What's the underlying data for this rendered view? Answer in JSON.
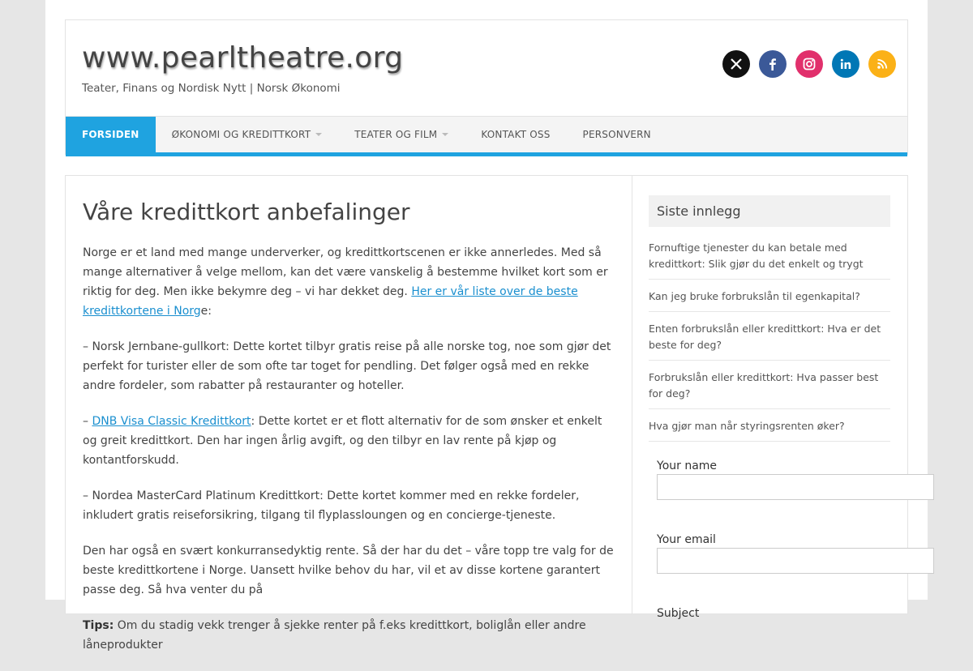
{
  "header": {
    "site_title": "www.pearltheatre.org",
    "tagline": "Teater, Finans og Nordisk Nytt | Norsk Økonomi"
  },
  "social": [
    {
      "name": "x-icon",
      "color": "#111111"
    },
    {
      "name": "facebook-icon",
      "color": "#3b5998"
    },
    {
      "name": "instagram-icon",
      "color": "#e1306c"
    },
    {
      "name": "linkedin-icon",
      "color": "#0077b5"
    },
    {
      "name": "rss-icon",
      "color": "#fbb117"
    }
  ],
  "nav": {
    "items": [
      {
        "label": "FORSIDEN"
      },
      {
        "label": "ØKONOMI OG KREDITTKORT"
      },
      {
        "label": "TEATER OG FILM"
      },
      {
        "label": "KONTAKT OSS"
      },
      {
        "label": "PERSONVERN"
      }
    ]
  },
  "accent_color": "#1fa3e0",
  "article": {
    "title": "Våre kredittkort anbefalinger",
    "p1_text": "Norge er et land med mange underverker, og kredittkortscenen er ikke annerledes. Med så mange alternativer å velge mellom, kan det være vanskelig å bestemme hvilket kort som er riktig for deg. Men ikke bekymre deg – vi har dekket deg. ",
    "p1_link": "Her er vår liste over de beste kredittkortene i Norg",
    "p1_end": "e:",
    "p2": "– Norsk Jernbane-gullkort: Dette kortet tilbyr gratis reise på alle norske tog, noe som gjør det perfekt for turister eller de som ofte tar toget for pendling. Det følger også med en rekke andre fordeler, som rabatter på restauranter og hoteller.",
    "p3_prefix": "– ",
    "p3_link": "DNB Visa Classic Kredittkort",
    "p3_text": ": Dette kortet er et flott alternativ for de som ønsker et enkelt og greit kredittkort. Den har ingen årlig avgift, og den tilbyr en lav rente på kjøp og kontantforskudd.",
    "p4": "– Nordea MasterCard Platinum Kredittkort: Dette kortet kommer med en rekke fordeler, inkludert gratis reiseforsikring, tilgang til flyplassloungen og en concierge-tjeneste.",
    "p5": "Den har også en svært konkurransedyktig rente. Så der har du det – våre topp tre valg for de beste kredittkortene i Norge. Uansett hvilke behov du har, vil et av disse kortene garantert passe deg. Så hva venter du på",
    "tips_label": "Tips:",
    "tips_text": " Om du stadig vekk trenger å sjekke renter på f.eks kredittkort, boliglån eller andre låneprodukter"
  },
  "sidebar": {
    "widget_title": "Siste innlegg",
    "posts": [
      {
        "label": "Fornuftige tjenester du kan betale med kredittkort: Slik gjør du det enkelt og trygt"
      },
      {
        "label": "Kan jeg bruke forbrukslån til egenkapital?"
      },
      {
        "label": "Enten forbrukslån eller kredittkort: Hva er det beste for deg?"
      },
      {
        "label": "Forbrukslån eller kredittkort: Hva passer best for deg?"
      },
      {
        "label": "Hva gjør man når styringsrenten øker?"
      }
    ],
    "form": {
      "name_label": "Your name",
      "email_label": "Your email",
      "subject_label": "Subject"
    }
  }
}
